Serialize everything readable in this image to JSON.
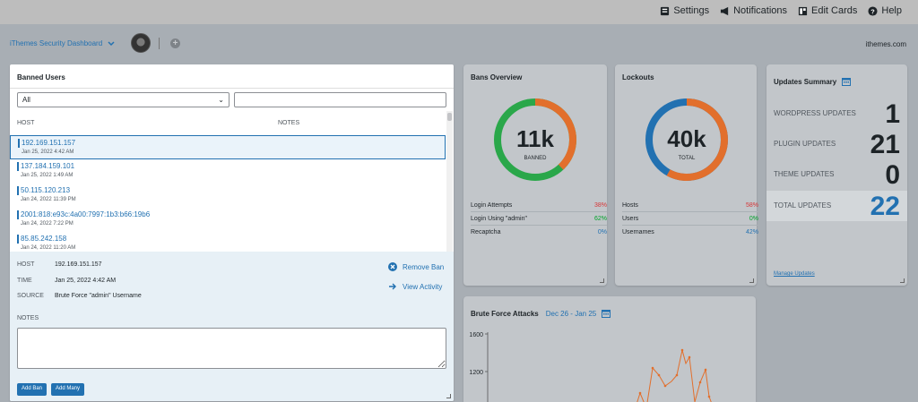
{
  "topbar": {
    "items": [
      {
        "label": "Settings",
        "icon": "settings-icon"
      },
      {
        "label": "Notifications",
        "icon": "megaphone-icon"
      },
      {
        "label": "Edit Cards",
        "icon": "edit-cards-icon"
      },
      {
        "label": "Help",
        "icon": "help-icon"
      }
    ]
  },
  "subbar": {
    "dashboard_title": "iThemes Security Dashboard",
    "site": "ithemes.com"
  },
  "banned_users": {
    "title": "Banned Users",
    "filter_value": "All",
    "search_value": "",
    "columns": {
      "host": "HOST",
      "notes": "NOTES"
    },
    "rows": [
      {
        "ip": "192.169.151.157",
        "date": "Jan 25, 2022 4:42 AM"
      },
      {
        "ip": "137.184.159.101",
        "date": "Jan 25, 2022 1:49 AM"
      },
      {
        "ip": "50.115.120.213",
        "date": "Jan 24, 2022 11:39 PM"
      },
      {
        "ip": "2001:818:e93c:4a00:7997:1b3:b66:19b6",
        "date": "Jan 24, 2022 7:22 PM"
      },
      {
        "ip": "85.85.242.158",
        "date": "Jan 24, 2022 11:20 AM"
      }
    ],
    "detail": {
      "host_label": "HOST",
      "host_value": "192.169.151.157",
      "time_label": "TIME",
      "time_value": "Jan 25, 2022 4:42 AM",
      "source_label": "SOURCE",
      "source_value": "Brute Force \"admin\" Username",
      "remove_ban": "Remove Ban",
      "view_activity": "View Activity",
      "notes_label": "NOTES",
      "notes_value": ""
    },
    "add_ban": "Add Ban",
    "add_many": "Add Many"
  },
  "bans_overview": {
    "title": "Bans Overview",
    "big_number": "11k",
    "caption": "BANNED",
    "stats": [
      {
        "label": "Login Attempts",
        "value": "38%",
        "color": "#d63638"
      },
      {
        "label": "Login Using \"admin\"",
        "value": "62%",
        "color": "#00a32a"
      },
      {
        "label": "Recaptcha",
        "value": "0%",
        "color": "#2271b1"
      }
    ],
    "ring_fraction_orange": 0.38
  },
  "lockouts": {
    "title": "Lockouts",
    "big_number": "40k",
    "caption": "TOTAL",
    "stats": [
      {
        "label": "Hosts",
        "value": "58%",
        "color": "#d63638"
      },
      {
        "label": "Users",
        "value": "0%",
        "color": "#00a32a"
      },
      {
        "label": "Usernames",
        "value": "42%",
        "color": "#2271b1"
      }
    ],
    "ring_fraction_orange": 0.58
  },
  "updates": {
    "title": "Updates Summary",
    "rows": [
      {
        "label": "WORDPRESS UPDATES",
        "value": "1"
      },
      {
        "label": "PLUGIN UPDATES",
        "value": "21"
      },
      {
        "label": "THEME UPDATES",
        "value": "0"
      },
      {
        "label": "TOTAL UPDATES",
        "value": "22"
      }
    ],
    "manage": "Manage Updates"
  },
  "brute_force": {
    "title": "Brute Force Attacks",
    "range": "Dec 26 - Jan 25",
    "y_ticks": [
      "1600",
      "1200"
    ]
  },
  "colors": {
    "accent": "#2271b1",
    "orange": "#e26f2c",
    "green": "#2aa74a"
  }
}
